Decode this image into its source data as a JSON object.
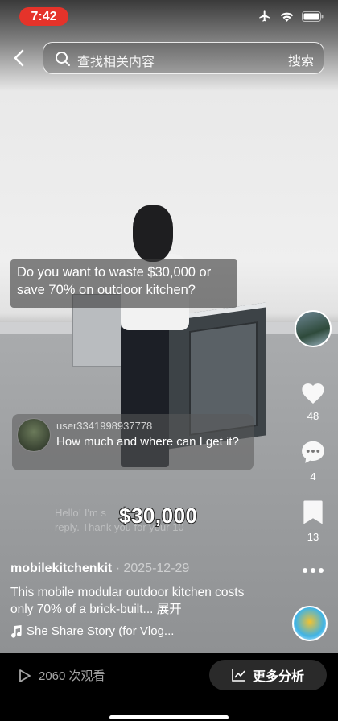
{
  "status_bar": {
    "time": "7:42"
  },
  "search": {
    "placeholder": "查找相关内容",
    "button_label": "搜索"
  },
  "caption": {
    "text": "Do you want to waste $30,000 or save 70% on outdoor kitchen?"
  },
  "comment": {
    "username": "user3341998937778",
    "text": "How much and where can I get it?"
  },
  "ghost_comment": {
    "line1": "Hello! I'm s",
    "line2": "reply. Thank you for your 10"
  },
  "price_overlay": "$30,000",
  "actions": {
    "likes": "48",
    "comments": "4",
    "saves": "13"
  },
  "post": {
    "author": "mobilekitchenkit",
    "separator": "·",
    "date": "2025-12-29",
    "description": "This mobile modular outdoor kitchen costs only 70% of a brick-built...",
    "expand_label": "展开",
    "music": "She Share Story (for Vlog..."
  },
  "bottom_bar": {
    "views": "2060 次观看",
    "analysis_label": "更多分析"
  },
  "colors": {
    "time_pill": "#e5332a",
    "bar_bg": "#000000",
    "button_bg": "#2a2a2a"
  }
}
